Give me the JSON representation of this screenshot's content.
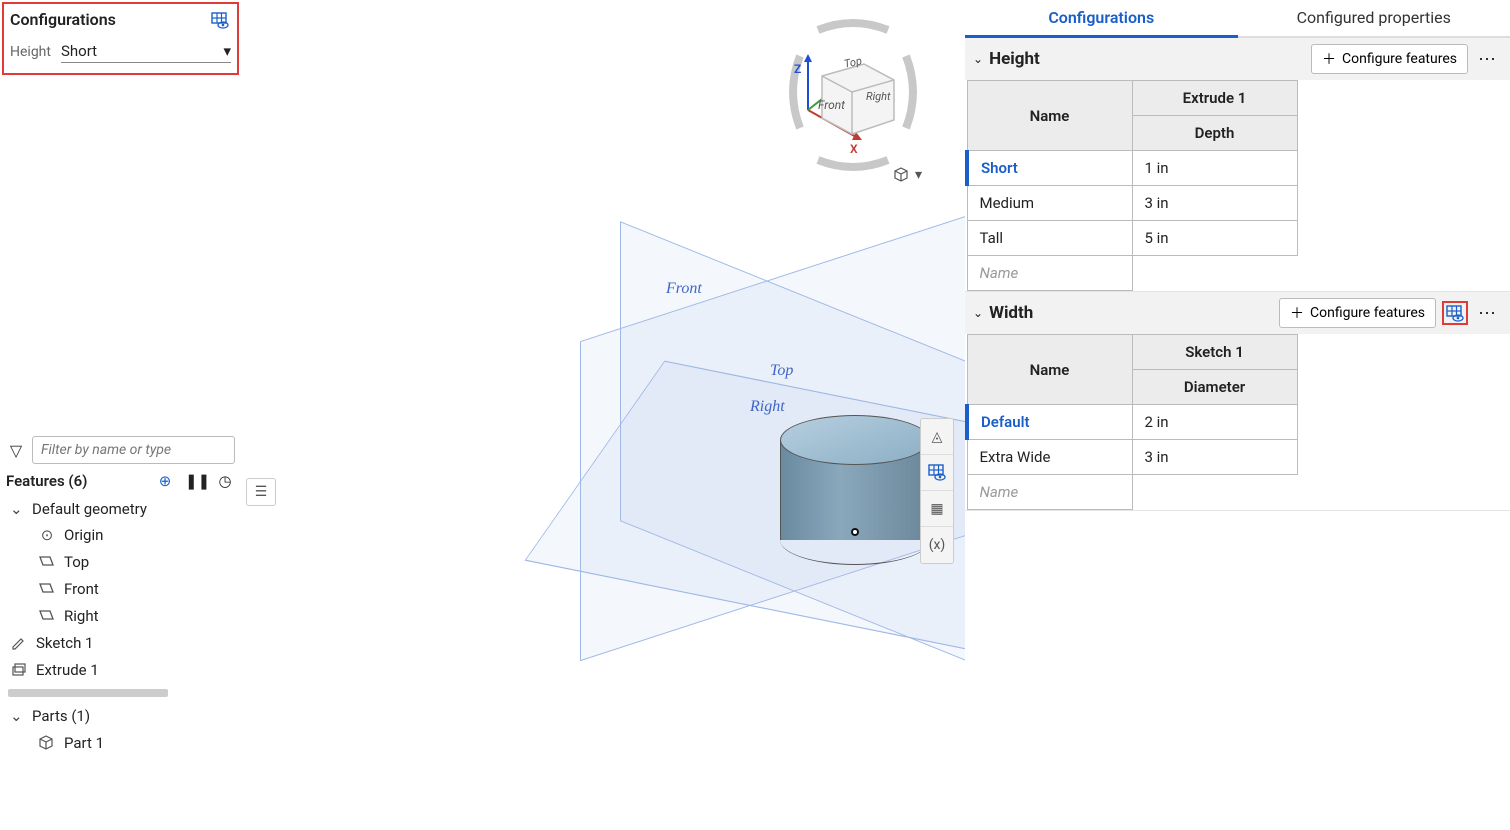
{
  "topConfig": {
    "title": "Configurations",
    "param_label": "Height",
    "selected_value": "Short"
  },
  "featurePanel": {
    "filter_placeholder": "Filter by name or type",
    "header": "Features (6)",
    "groups": {
      "default_geometry": "Default geometry",
      "origin": "Origin",
      "top": "Top",
      "front": "Front",
      "right": "Right"
    },
    "sketch": "Sketch 1",
    "extrude": "Extrude 1",
    "parts_header": "Parts (1)",
    "part": "Part 1"
  },
  "viewport": {
    "plane_front": "Front",
    "plane_top": "Top",
    "plane_right": "Right",
    "axis_z": "Z",
    "axis_x": "X",
    "cube_front": "Front",
    "cube_right": "Right",
    "cube_top": "Top"
  },
  "rightPanel": {
    "tabs": {
      "configurations": "Configurations",
      "configured_properties": "Configured properties"
    },
    "configure_features_label": "Configure features",
    "sections": [
      {
        "title": "Height",
        "feature_header": "Extrude 1",
        "name_header": "Name",
        "value_header": "Depth",
        "rows": [
          {
            "name": "Short",
            "value": "1 in",
            "active": true
          },
          {
            "name": "Medium",
            "value": "3 in",
            "active": false
          },
          {
            "name": "Tall",
            "value": "5 in",
            "active": false
          }
        ],
        "new_row_placeholder": "Name",
        "highlight_icon": false
      },
      {
        "title": "Width",
        "feature_header": "Sketch 1",
        "name_header": "Name",
        "value_header": "Diameter",
        "rows": [
          {
            "name": "Default",
            "value": "2 in",
            "active": true
          },
          {
            "name": "Extra Wide",
            "value": "3 in",
            "active": false
          }
        ],
        "new_row_placeholder": "Name",
        "highlight_icon": true
      }
    ]
  }
}
